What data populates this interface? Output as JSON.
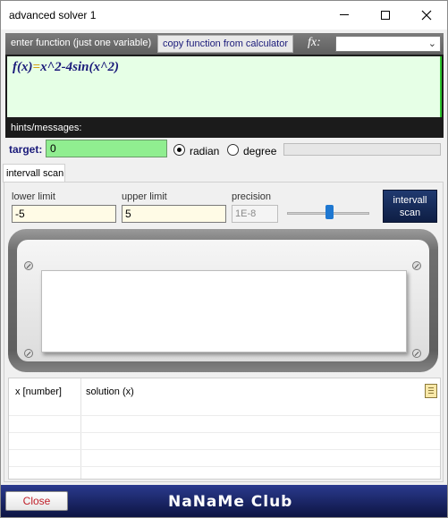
{
  "window": {
    "title": "advanced solver 1"
  },
  "function_panel": {
    "header_label": "enter function (just one variable)",
    "copy_button_label": "copy function from calculator",
    "fx_label": "fx:",
    "fx_selected": "",
    "function_lhs": "f(x)",
    "function_eq": "=",
    "function_rhs": "x^2-4sin(x^2)",
    "hints_label": "hints/messages:"
  },
  "target": {
    "label": "target",
    "colon": ":",
    "value": "0",
    "angle_mode": "radian",
    "radian_label": "radian",
    "degree_label": "degree"
  },
  "tab": {
    "label": "intervall scan"
  },
  "scan": {
    "lower_label": "lower limit",
    "lower_value": "-5",
    "upper_label": "upper limit",
    "upper_value": "5",
    "precision_label": "precision",
    "precision_value": "1E-8",
    "precision_slider_fraction": 0.52,
    "button_line1": "intervall",
    "button_line2": "scan"
  },
  "results": {
    "col1": "x [number]",
    "col2": "solution (x)",
    "rows": []
  },
  "footer": {
    "close_label": "Close",
    "brand": "NaNaMe Club"
  },
  "colors": {
    "function_bg": "#e6ffe6",
    "target_bg": "#90ee90",
    "limit_bg": "#fffbe6",
    "scan_button": "#0e1e44",
    "footer": "#1a2266"
  },
  "icons": [
    "minimize-icon",
    "maximize-icon",
    "close-icon",
    "chevron-down-icon",
    "copy-results-icon",
    "screw-icon"
  ]
}
